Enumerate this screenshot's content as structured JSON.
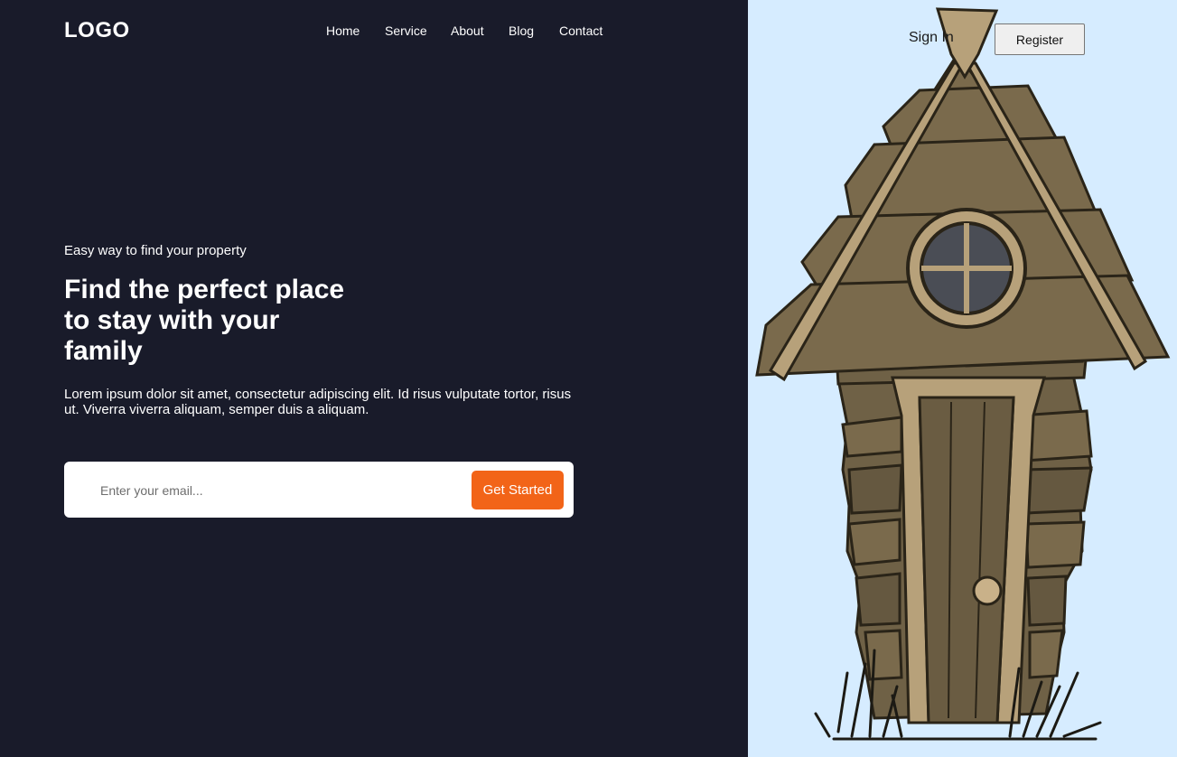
{
  "header": {
    "logo": "LOGO",
    "nav": [
      "Home",
      "Service",
      "About",
      "Blog",
      "Contact"
    ],
    "sign_in": "Sign In",
    "register": "Register"
  },
  "hero": {
    "tagline": "Easy way to find your property",
    "headline": "Find the perfect place to stay with your family",
    "description": "Lorem ipsum dolor sit amet, consectetur adipiscing elit. Id risus vulputate tortor, risus ut. Viverra viverra aliquam, semper duis a aliquam.",
    "email_placeholder": "Enter your email...",
    "cta": "Get Started"
  },
  "colors": {
    "left_bg": "#191b2a",
    "right_bg": "#d6ecff",
    "accent": "#f26418"
  },
  "illustration": "wooden-house-illustration"
}
